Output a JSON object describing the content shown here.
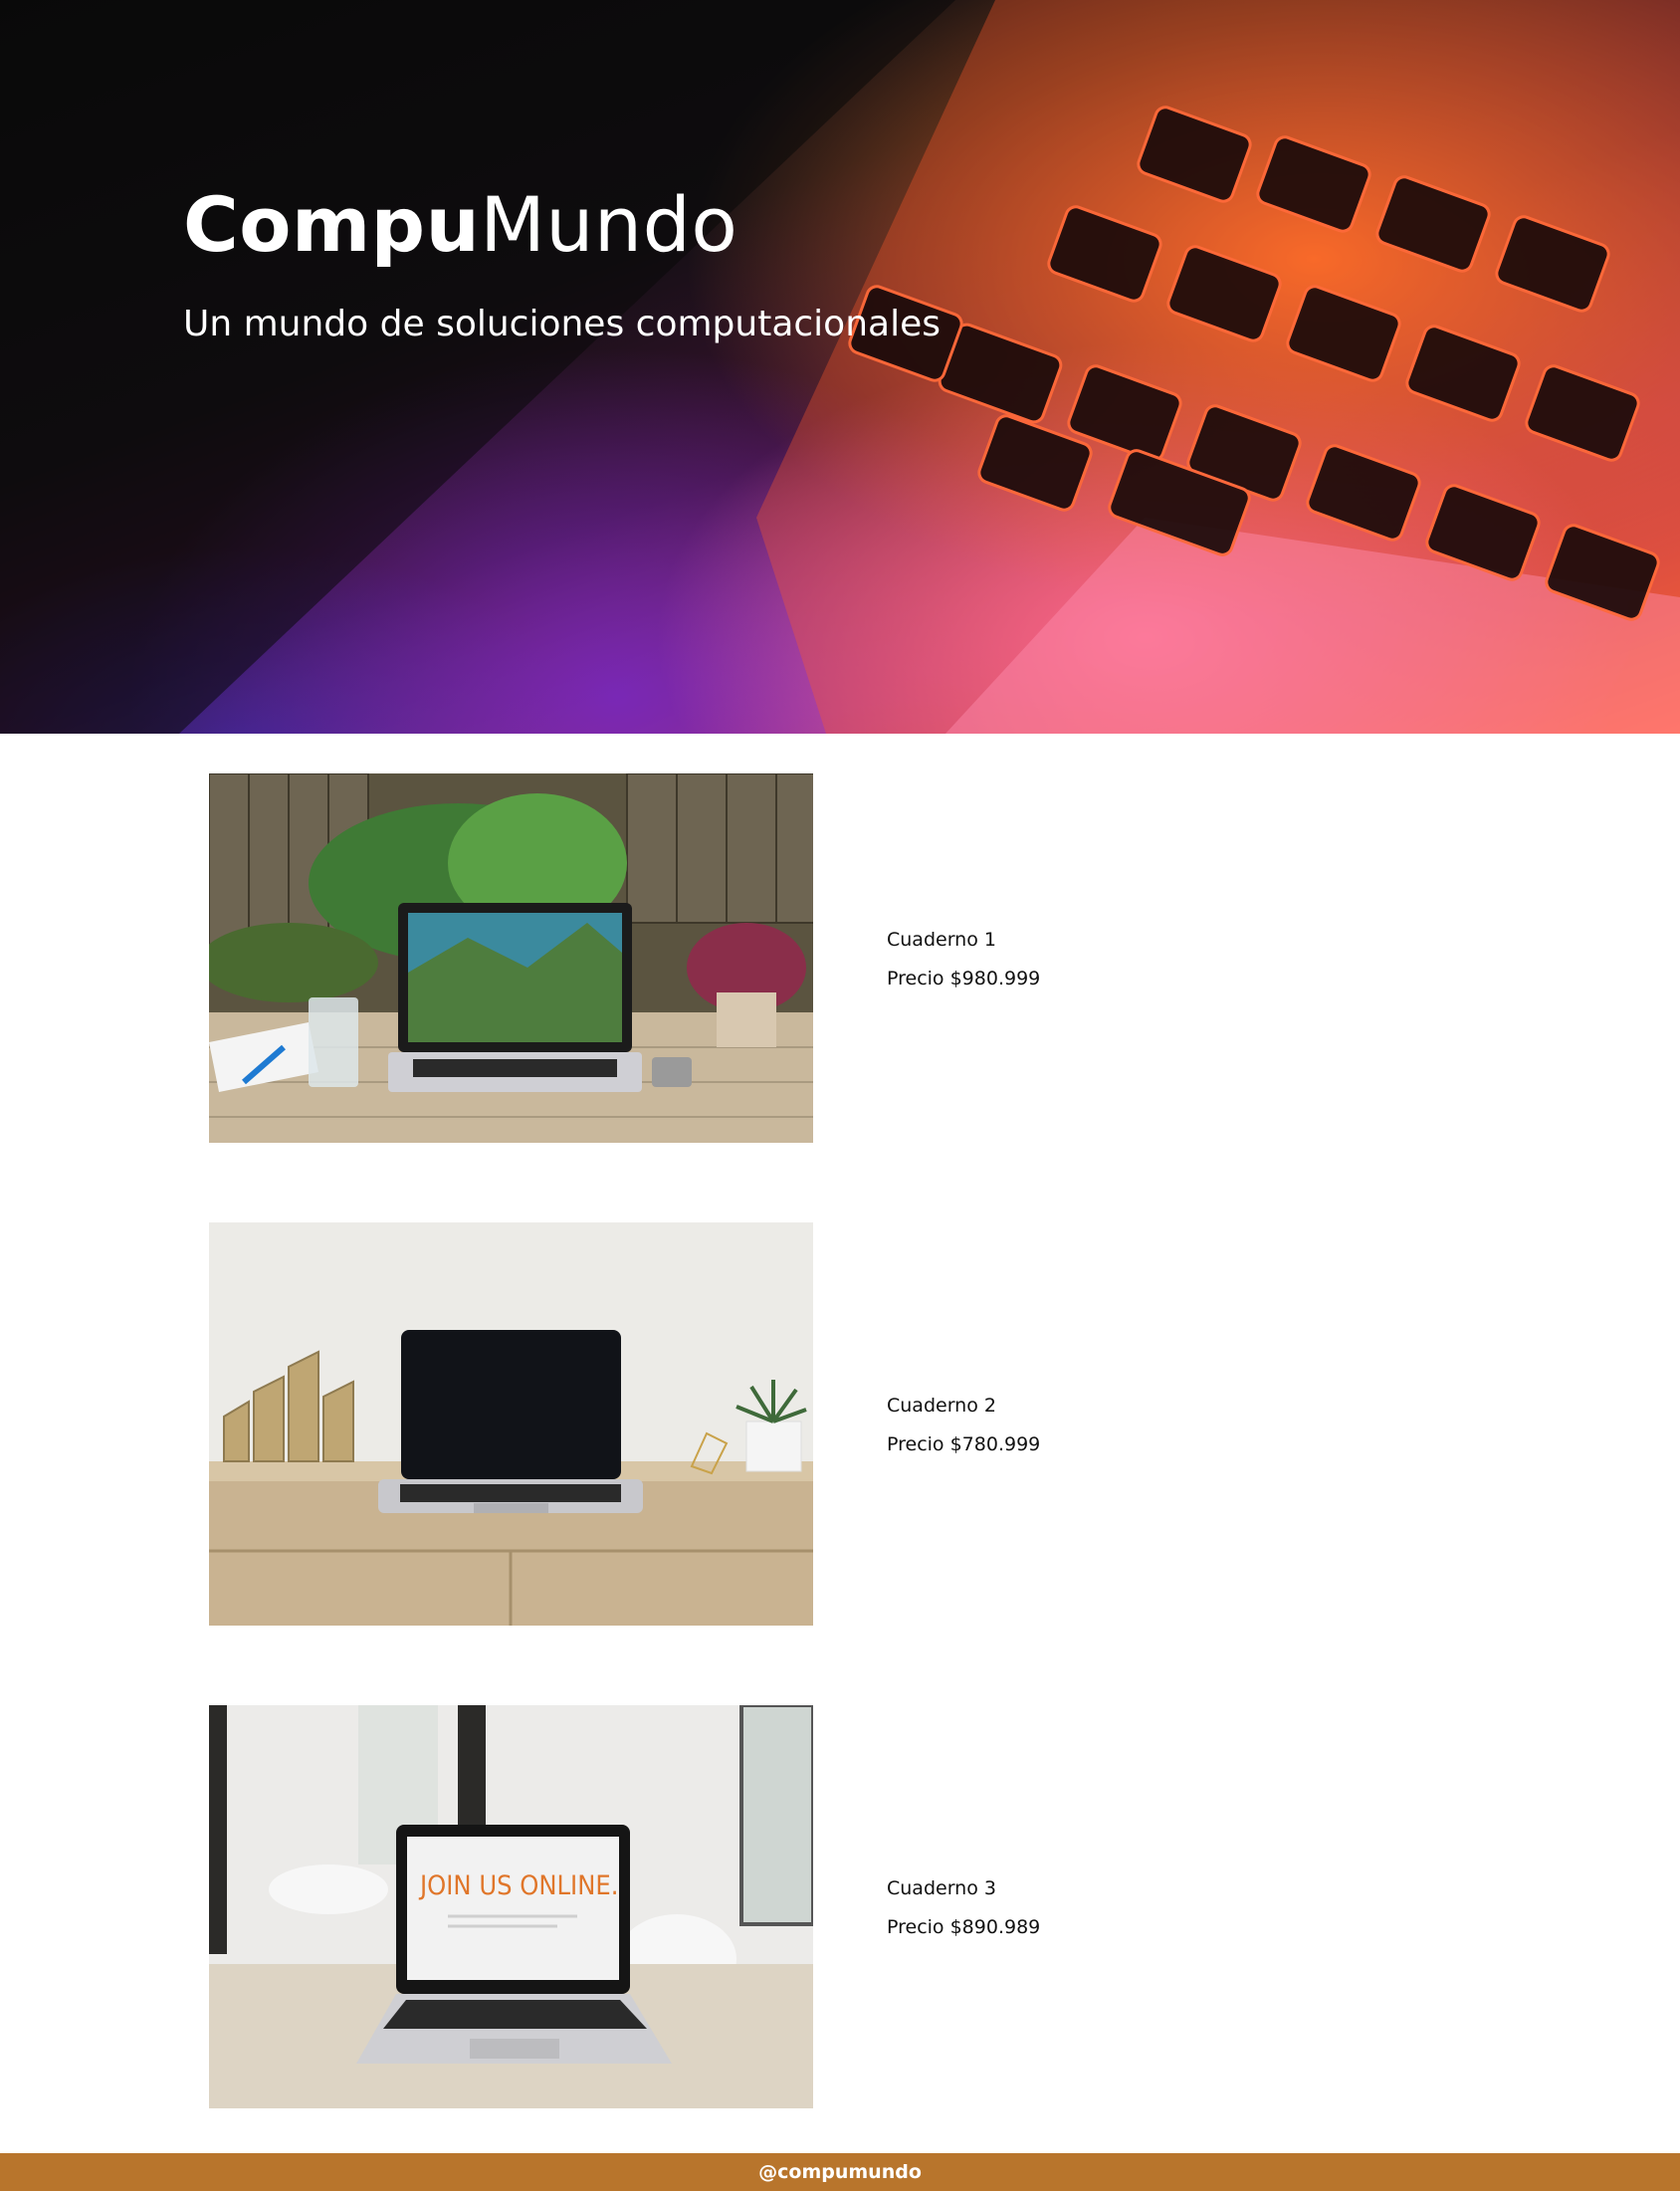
{
  "hero": {
    "title_bold": "Compu",
    "title_rest": "Mundo",
    "subtitle": "Un mundo de soluciones computacionales"
  },
  "products": [
    {
      "name": "Cuaderno 1",
      "price": "Precio $980.999"
    },
    {
      "name": "Cuaderno 2",
      "price": "Precio $780.999"
    },
    {
      "name": "Cuaderno 3",
      "price": "Precio $890.989"
    }
  ],
  "product3_screen_text": "JOIN US ONLINE.",
  "footer": {
    "handle": "@compumundo"
  },
  "colors": {
    "footer_bg": "#b8752c",
    "hero_orange": "#ff6a3a",
    "hero_purple": "#7a2ac8"
  }
}
